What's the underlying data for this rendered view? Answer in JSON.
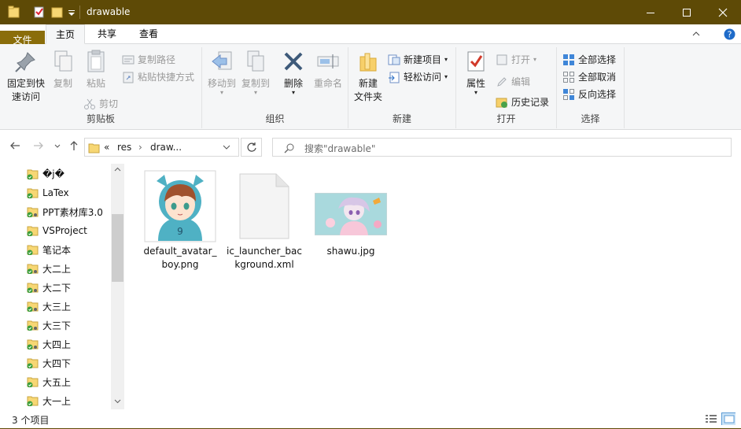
{
  "window": {
    "title": "drawable",
    "minimize_icon": "minimize-icon",
    "maximize_icon": "maximize-icon",
    "close_icon": "close-icon",
    "accent": "#5e4a06"
  },
  "ribbon_tabs": {
    "file": "文件",
    "home": "主页",
    "share": "共享",
    "view": "查看"
  },
  "ribbon": {
    "clipboard": {
      "label": "剪贴板",
      "pin_line1": "固定到快",
      "pin_line2": "速访问",
      "copy": "复制",
      "paste": "粘贴",
      "copy_path": "复制路径",
      "paste_shortcut": "粘贴快捷方式",
      "cut": "剪切"
    },
    "organize": {
      "label": "组织",
      "move_to": "移动到",
      "copy_to": "复制到",
      "delete": "删除",
      "rename": "重命名"
    },
    "new": {
      "label": "新建",
      "new_folder_line1": "新建",
      "new_folder_line2": "文件夹",
      "new_item": "新建项目",
      "easy_access": "轻松访问"
    },
    "open": {
      "label": "打开",
      "properties": "属性",
      "open": "打开",
      "edit": "编辑",
      "history": "历史记录"
    },
    "select": {
      "label": "选择",
      "select_all": "全部选择",
      "select_none": "全部取消",
      "invert": "反向选择"
    }
  },
  "address": {
    "overflow": "«",
    "crumbs": [
      "res",
      "draw..."
    ],
    "search_placeholder": "搜索\"drawable\""
  },
  "nav_pane": {
    "items": [
      "�j�",
      "LaTex",
      "PPT素材库3.0",
      "VSProject",
      "笔记本",
      "大二上",
      "大二下",
      "大三上",
      "大三下",
      "大四上",
      "大四下",
      "大五上",
      "大一上"
    ]
  },
  "files": [
    {
      "name": "default_avatar_boy.png",
      "label_line1": "default_avatar_",
      "label_line2": "boy.png"
    },
    {
      "name": "ic_launcher_background.xml",
      "label_line1": "ic_launcher_bac",
      "label_line2": "kground.xml"
    },
    {
      "name": "shawu.jpg",
      "label_line1": "shawu.jpg",
      "label_line2": ""
    }
  ],
  "status": {
    "count": "3 个项目"
  }
}
